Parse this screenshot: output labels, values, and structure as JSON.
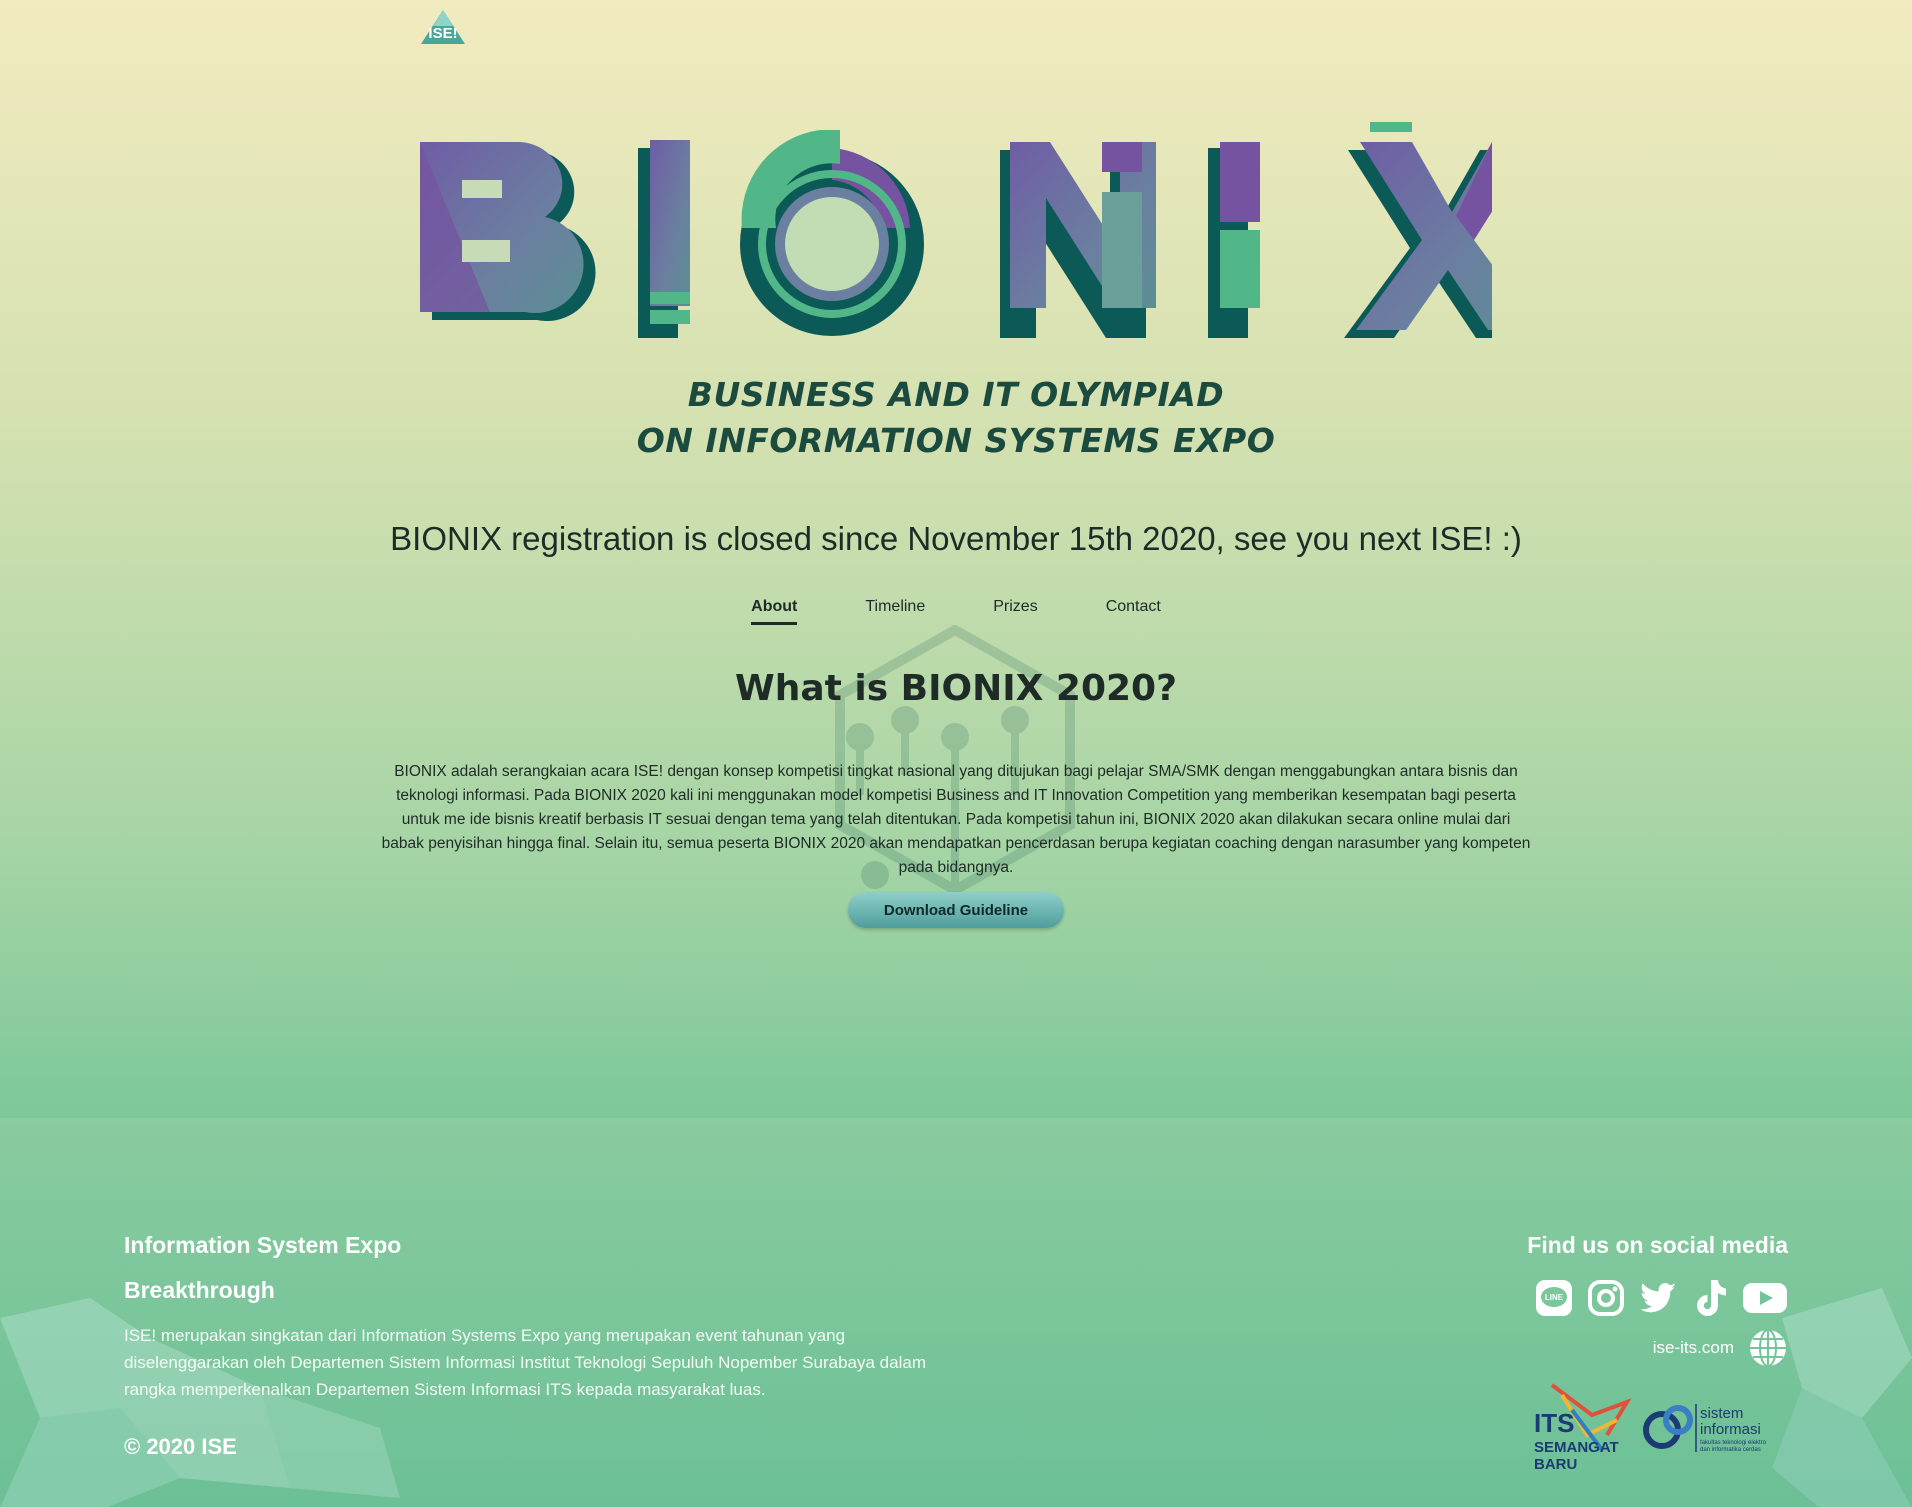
{
  "header": {
    "logo_text": "ISE!"
  },
  "hero": {
    "title_letters": [
      "B",
      "I",
      "O",
      "N",
      "I",
      "X"
    ],
    "subtitle_line1": "BUSINESS AND IT OLYMPIAD",
    "subtitle_line2": "ON INFORMATION SYSTEMS EXPO"
  },
  "notice": "BIONIX registration is closed since November 15th 2020, see you next ISE! :)",
  "tabs": [
    {
      "label": "About",
      "active": true
    },
    {
      "label": "Timeline",
      "active": false
    },
    {
      "label": "Prizes",
      "active": false
    },
    {
      "label": "Contact",
      "active": false
    }
  ],
  "about": {
    "heading": "What is BIONIX 2020?",
    "body": "BIONIX adalah serangkaian acara ISE! dengan konsep kompetisi tingkat nasional yang ditujukan bagi pelajar SMA/SMK dengan menggabungkan antara bisnis dan teknologi informasi. Pada BIONIX 2020 kali ini menggunakan model kompetisi Business and IT Innovation Competition yang memberikan kesempatan bagi peserta untuk me ide bisnis kreatif berbasis IT sesuai dengan tema yang telah ditentukan. Pada kompetisi tahun ini, BIONIX 2020 akan dilakukan secara online mulai dari babak penyisihan hingga final. Selain itu, semua peserta BIONIX 2020 akan mendapatkan pencerdasan berupa kegiatan coaching dengan narasumber yang kompeten pada bidangnya.",
    "download_label": "Download Guideline"
  },
  "footer": {
    "title": "Information System Expo",
    "subtitle": "Breakthrough",
    "description": "ISE! merupakan singkatan dari Information Systems Expo yang merupakan event tahunan yang diselenggarakan oleh Departemen Sistem Informasi Institut Teknologi Sepuluh Nopember Surabaya dalam rangka memperkenalkan Departemen Sistem Informasi ITS kepada masyarakat luas.",
    "copyright": "© 2020 ISE",
    "social_title": "Find us on social media",
    "socials": [
      "line-icon",
      "instagram-icon",
      "twitter-icon",
      "tiktok-icon",
      "youtube-icon"
    ],
    "website": "ise-its.com",
    "its_logo": {
      "line1": "ITS",
      "line2": "SEMANGAT",
      "line3": "BARU"
    },
    "si_logo": {
      "line1": "sistem",
      "line2": "informasi",
      "line3": "fakultas teknologi elektro",
      "line4": "dan informatika cerdas"
    }
  },
  "colors": {
    "purple": "#7553a0",
    "teal_dark": "#0c5a57",
    "green": "#52b788",
    "text_dark": "#1f2b26"
  }
}
